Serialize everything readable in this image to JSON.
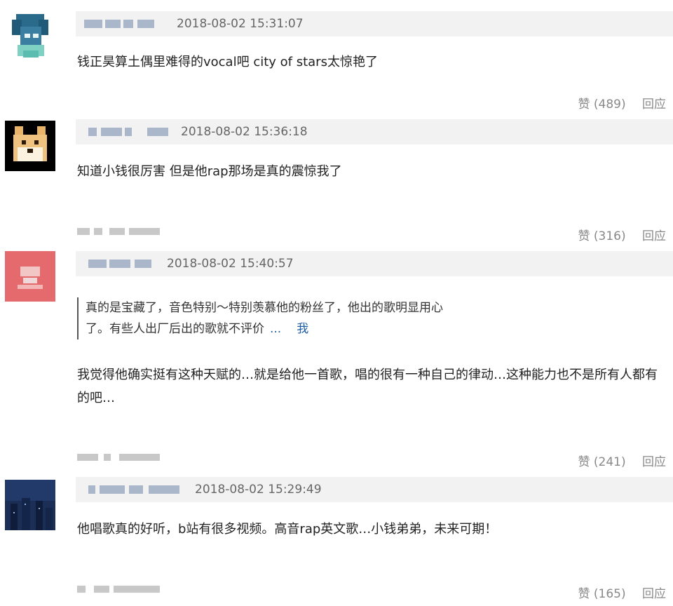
{
  "comments": [
    {
      "timestamp": "2018-08-02 15:31:07",
      "text": "钱正昊算土偶里难得的vocal吧 city of stars太惊艳了",
      "likes": "赞 (489)",
      "reply": "回应",
      "avatar_icon": "blue-cartoon-avatar-icon"
    },
    {
      "timestamp": "2018-08-02 15:36:18",
      "text": "知道小钱很厉害 但是他rap那场是真的震惊我了",
      "likes": "赞 (316)",
      "reply": "回应",
      "avatar_icon": "doge-avatar-icon"
    },
    {
      "timestamp": "2018-08-02 15:40:57",
      "quote_line1": "真的是宝藏了，音色特别～特别羡慕他的粉丝了，他出的歌明显用心",
      "quote_line2": "了。有些人出厂后出的歌就不评价",
      "quote_more": "...",
      "quote_me": "我",
      "text": "我觉得他确实挺有这种天赋的…就是给他一首歌，唱的很有一种自己的律动…这种能力也不是所有人都有的吧…",
      "likes": "赞 (241)",
      "reply": "回应",
      "avatar_icon": "pink-avatar-icon"
    },
    {
      "timestamp": "2018-08-02 15:29:49",
      "text": "他唱歌真的好听，b站有很多视频。高音rap英文歌…小钱弟弟，未来可期！",
      "likes": "赞 (165)",
      "reply": "回应",
      "avatar_icon": "night-scene-avatar-icon"
    }
  ]
}
